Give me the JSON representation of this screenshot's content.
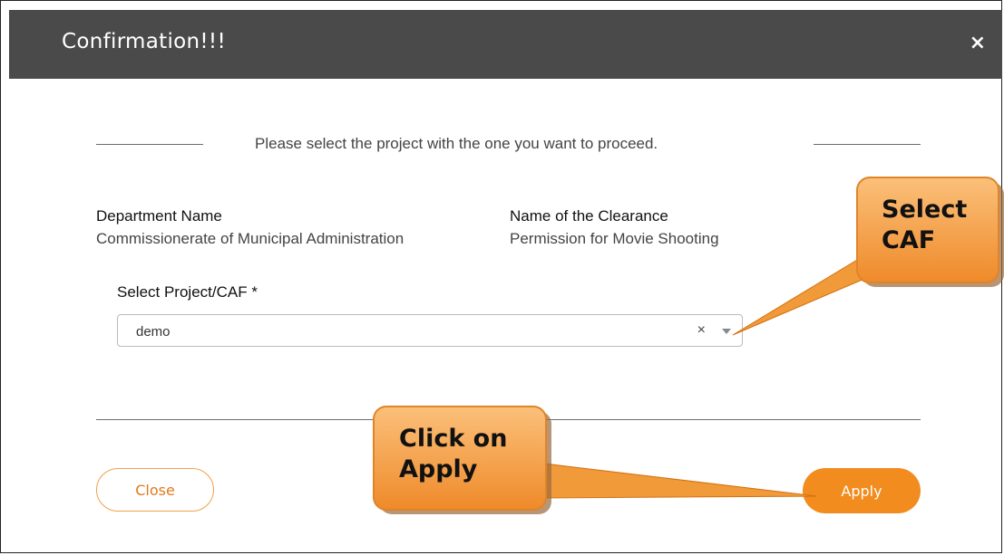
{
  "modal": {
    "title": "Confirmation!!!",
    "close_glyph": "×",
    "instruction": "Please select the project with the one you want to proceed."
  },
  "details": {
    "department_label": "Department Name",
    "department_value": "Commissionerate of Municipal Administration",
    "clearance_label": "Name of the Clearance",
    "clearance_value": "Permission for Movie Shooting"
  },
  "select": {
    "label": "Select Project/CAF *",
    "value": "demo",
    "clear_glyph": "×",
    "arrow_icon": "chevron-down-icon"
  },
  "buttons": {
    "close_label": "Close",
    "apply_label": "Apply"
  },
  "callouts": {
    "select_caf_line1": "Select",
    "select_caf_line2": "CAF",
    "click_apply_line1": "Click on",
    "click_apply_line2": "Apply"
  },
  "colors": {
    "header_bg": "#4a4a4a",
    "accent": "#f28c1e",
    "callout_fill": "#f5a04a"
  }
}
